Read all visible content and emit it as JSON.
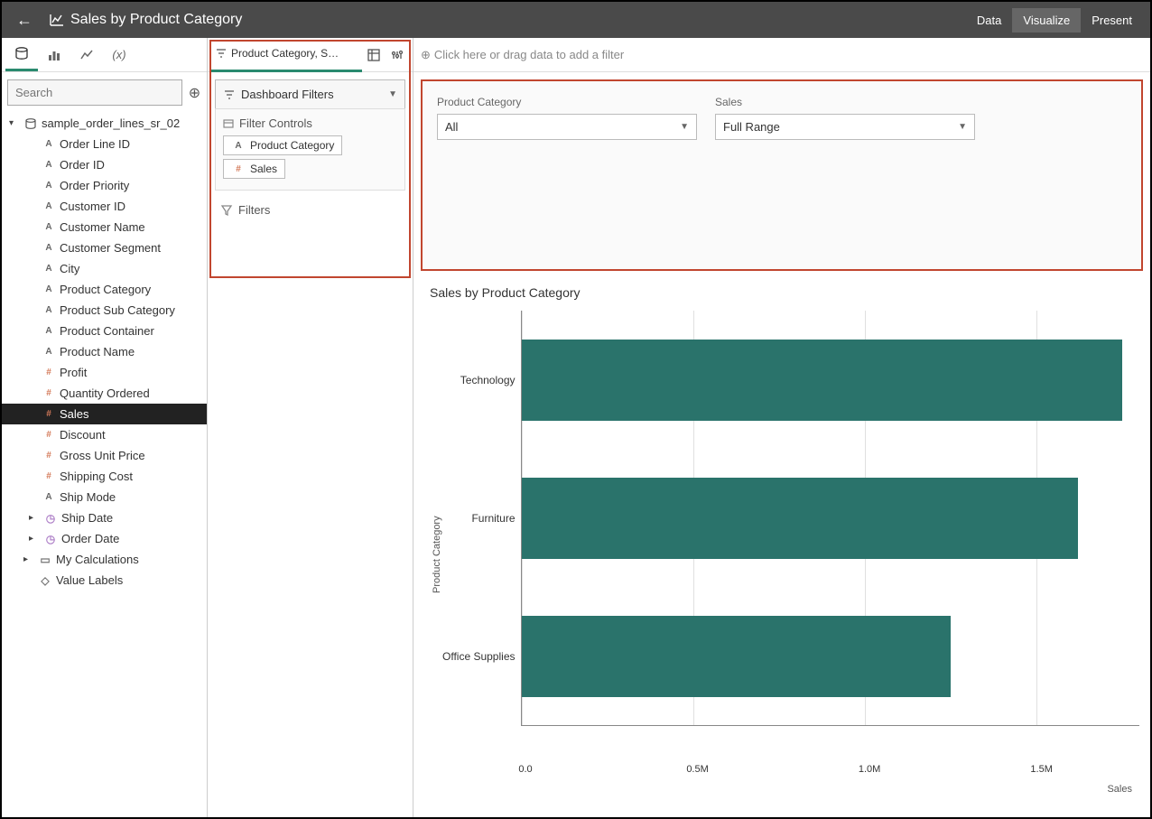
{
  "header": {
    "title": "Sales by Product Category",
    "tabs": {
      "data": "Data",
      "visualize": "Visualize",
      "present": "Present"
    }
  },
  "search": {
    "placeholder": "Search"
  },
  "dataset": {
    "name": "sample_order_lines_sr_02",
    "fields": [
      {
        "name": "Order Line ID",
        "type": "txt"
      },
      {
        "name": "Order ID",
        "type": "txt"
      },
      {
        "name": "Order Priority",
        "type": "txt"
      },
      {
        "name": "Customer ID",
        "type": "txt"
      },
      {
        "name": "Customer Name",
        "type": "txt"
      },
      {
        "name": "Customer Segment",
        "type": "txt"
      },
      {
        "name": "City",
        "type": "txt"
      },
      {
        "name": "Product Category",
        "type": "txt"
      },
      {
        "name": "Product Sub Category",
        "type": "txt"
      },
      {
        "name": "Product Container",
        "type": "txt"
      },
      {
        "name": "Product Name",
        "type": "txt"
      },
      {
        "name": "Profit",
        "type": "num"
      },
      {
        "name": "Quantity Ordered",
        "type": "num"
      },
      {
        "name": "Sales",
        "type": "num",
        "selected": true
      },
      {
        "name": "Discount",
        "type": "num"
      },
      {
        "name": "Gross Unit Price",
        "type": "num"
      },
      {
        "name": "Shipping Cost",
        "type": "num"
      },
      {
        "name": "Ship Mode",
        "type": "txt"
      },
      {
        "name": "Ship Date",
        "type": "clk",
        "caret": true
      },
      {
        "name": "Order Date",
        "type": "clk",
        "caret": true
      }
    ],
    "my_calculations": "My Calculations",
    "value_labels": "Value Labels"
  },
  "mid": {
    "tab_label": "Product Category, S…",
    "dashboard_filters": "Dashboard Filters",
    "filter_controls": "Filter Controls",
    "pill1": "Product Category",
    "pill2": "Sales",
    "filters": "Filters"
  },
  "filter_hint": "Click here or drag data to add a filter",
  "filter_panel": {
    "product_category": {
      "label": "Product Category",
      "value": "All"
    },
    "sales": {
      "label": "Sales",
      "value": "Full Range"
    }
  },
  "chart_title": "Sales by Product Category",
  "chart_data": {
    "type": "bar",
    "orientation": "horizontal",
    "categories": [
      "Technology",
      "Furniture",
      "Office Supplies"
    ],
    "values": [
      1750000,
      1620000,
      1250000
    ],
    "xlabel": "Sales",
    "ylabel": "Product Category",
    "xlim": [
      0,
      1800000
    ],
    "x_ticks": [
      0,
      500000,
      1000000,
      1500000
    ],
    "x_tick_labels": [
      "0.0",
      "0.5M",
      "1.0M",
      "1.5M"
    ],
    "bar_color": "#2a736b"
  }
}
